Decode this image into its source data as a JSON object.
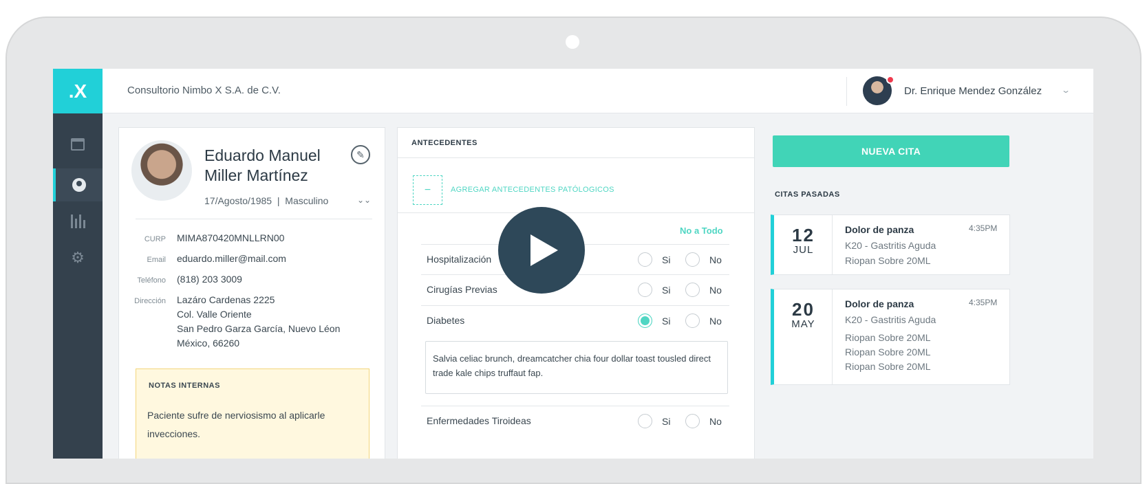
{
  "app": {
    "logo_text": ".X",
    "company": "Consultorio Nimbo X S.A. de C.V.",
    "user_name": "Dr. Enrique Mendez González",
    "accent_color": "#21d0d8",
    "success_color": "#41d4b7"
  },
  "sidebar": {
    "items": [
      {
        "icon": "calendar-icon"
      },
      {
        "icon": "user-icon",
        "active": true
      },
      {
        "icon": "stats-icon"
      },
      {
        "icon": "gear-icon"
      }
    ]
  },
  "patient": {
    "name_line1": "Eduardo Manuel",
    "name_line2": "Miller Martínez",
    "birth_gender": "17/Agosto/1985  |  Masculino",
    "curp_label": "CURP",
    "curp": "MIMA870420MNLLRN00",
    "email_label": "Email",
    "email": "eduardo.miller@mail.com",
    "phone_label": "Teléfono",
    "phone": "(818) 203 3009",
    "address_label": "Dirección",
    "address_line1": "Lazáro Cardenas 2225",
    "address_line2": "Col. Valle Oriente",
    "address_line3": "San Pedro Garza García, Nuevo Léon",
    "address_line4": "México, 66260",
    "notes_title": "NOTAS INTERNAS",
    "notes_text": "Paciente sufre de nerviosismo al aplicarle invecciones."
  },
  "antecedentes": {
    "title": "ANTECEDENTES",
    "add_label": "AGREGAR ANTECEDENTES PATÓLOGICOS",
    "add_icon": "−",
    "no_todo": "No a Todo",
    "yes_label": "Si",
    "no_label": "No",
    "conditions": [
      {
        "label": "Hospitalización",
        "selected": "none"
      },
      {
        "label": "Cirugías Previas",
        "selected": "none"
      },
      {
        "label": "Diabetes",
        "selected": "si"
      },
      {
        "label": "Enfermedades Tiroideas",
        "selected": "none"
      }
    ],
    "diabetes_note": "Salvia celiac brunch, dreamcatcher chia four dollar toast tousled direct trade kale chips truffaut fap."
  },
  "citas": {
    "new_button": "NUEVA CITA",
    "past_title": "CITAS PASADAS",
    "items": [
      {
        "day": "12",
        "month": "JUL",
        "reason": "Dolor de panza",
        "time": "4:35PM",
        "lines": [
          "K20 - Gastritis Aguda",
          "Riopan Sobre 20ML"
        ]
      },
      {
        "day": "20",
        "month": "MAY",
        "reason": "Dolor de panza",
        "time": "4:35PM",
        "lines": [
          "K20 - Gastritis Aguda",
          "Riopan Sobre 20ML",
          "Riopan Sobre 20ML",
          "Riopan Sobre 20ML"
        ]
      }
    ]
  },
  "video": {
    "play_icon": "play-icon"
  }
}
